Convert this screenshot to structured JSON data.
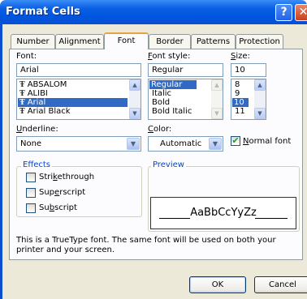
{
  "window": {
    "title": "Format Cells",
    "help_icon": "?",
    "close_icon": "✕"
  },
  "tabs": [
    "Number",
    "Alignment",
    "Font",
    "Border",
    "Patterns",
    "Protection"
  ],
  "active_tab": "Font",
  "font": {
    "label": "Font:",
    "value": "Arial",
    "items": [
      "ABSALOM",
      "ALIBI",
      "Arial",
      "Arial Black"
    ],
    "selected": "Arial",
    "item_icon": "truetype-icon"
  },
  "font_style": {
    "label": "Font style:",
    "value": "Regular",
    "items": [
      "Regular",
      "Italic",
      "Bold",
      "Bold Italic"
    ],
    "selected": "Regular"
  },
  "size": {
    "label": "Size:",
    "value": "10",
    "items": [
      "8",
      "9",
      "10",
      "11"
    ],
    "selected": "10"
  },
  "underline": {
    "label": "Underline:",
    "value": "None"
  },
  "color": {
    "label": "Color:",
    "value": "Automatic"
  },
  "normal_font": {
    "label": "Normal font",
    "checked": true
  },
  "effects": {
    "label": "Effects",
    "items": [
      {
        "label": "Strikethrough",
        "checked": false
      },
      {
        "label": "Superscript",
        "checked": false
      },
      {
        "label": "Subscript",
        "checked": false
      }
    ]
  },
  "preview": {
    "label": "Preview",
    "text": "AaBbCcYyZz"
  },
  "info_text": "This is a TrueType font.  The same font will be used on both your printer and your screen.",
  "buttons": {
    "ok": "OK",
    "cancel": "Cancel"
  },
  "colors": {
    "title_bar": "#0055e0",
    "dialog_bg": "#ece9d8",
    "selection": "#316ac5",
    "group_label": "#0046d5",
    "tab_highlight": "#e6a23c"
  }
}
